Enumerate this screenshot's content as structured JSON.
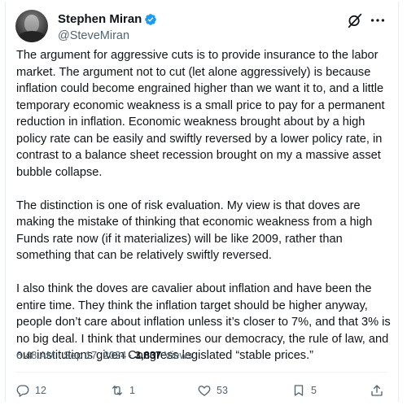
{
  "author": {
    "display_name": "Stephen Miran",
    "handle": "@SteveMiran"
  },
  "post": {
    "paragraphs": [
      "The argument for aggressive cuts is to provide insurance to the labor market. The argument not to cut (let alone aggressively) is because inflation could become engrained higher than we want it to, and a little temporary economic weakness is a small price to pay for a permanent reduction in inflation. Economic weakness brought about by a high policy rate can be easily and swiftly reversed by a lower policy rate, in contrast to a balance sheet recession brought on my a massive asset bubble collapse.",
      "The distinction is one of risk evaluation. My view is that doves are making the mistake of thinking that economic weakness from a high Funds rate now (if it materializes) will be like 2009, rather than something that can be relatively swiftly reversed.",
      "I also think the doves are cavalier about inflation and have been the entire time. They think the inflation target should be higher anyway, people don’t care about inflation unless it’s closer to 7%, and that 3% is no big deal. I think that undermines our democracy, the rule of law, and our institutions given Congress legislated “stable prices.”"
    ]
  },
  "meta": {
    "time": "6:48 AM",
    "date": "Sep 17, 2024",
    "separator": "·",
    "views_count": "3,837",
    "views_label": "Views"
  },
  "actions": {
    "replies": "12",
    "reposts": "1",
    "likes": "53",
    "bookmarks": "5"
  },
  "icons": {
    "verified": "verified-badge-icon",
    "grok": "grok-icon",
    "more": "more-icon",
    "reply": "reply-icon",
    "repost": "repost-icon",
    "like": "heart-icon",
    "bookmark": "bookmark-icon",
    "share": "share-icon"
  },
  "colors": {
    "text": "#0f1419",
    "secondary": "#536471",
    "verified": "#1d9bf0",
    "divider": "#eff3f4"
  }
}
